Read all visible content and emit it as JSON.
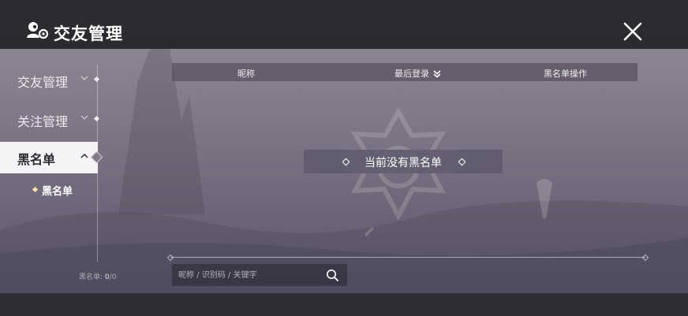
{
  "header": {
    "title": "交友管理",
    "close_icon": "close-icon",
    "logo_icon": "friends-settings-icon"
  },
  "sidebar": {
    "items": [
      {
        "label": "交友管理",
        "expanded": false
      },
      {
        "label": "关注管理",
        "expanded": false
      },
      {
        "label": "黑名单",
        "expanded": true,
        "active": true
      }
    ],
    "sub_item": "黑名单",
    "count_label": "黑名单:",
    "count_value": "0",
    "count_total": "/0"
  },
  "table": {
    "columns": [
      "昵称",
      "最后登录",
      "黑名单操作"
    ],
    "sorted_column": "最后登录",
    "sort_direction": "descending"
  },
  "empty_message": "当前没有黑名单",
  "search": {
    "placeholder": "昵称 / 识别码 / 关键字",
    "value": "",
    "icon": "search-icon"
  }
}
